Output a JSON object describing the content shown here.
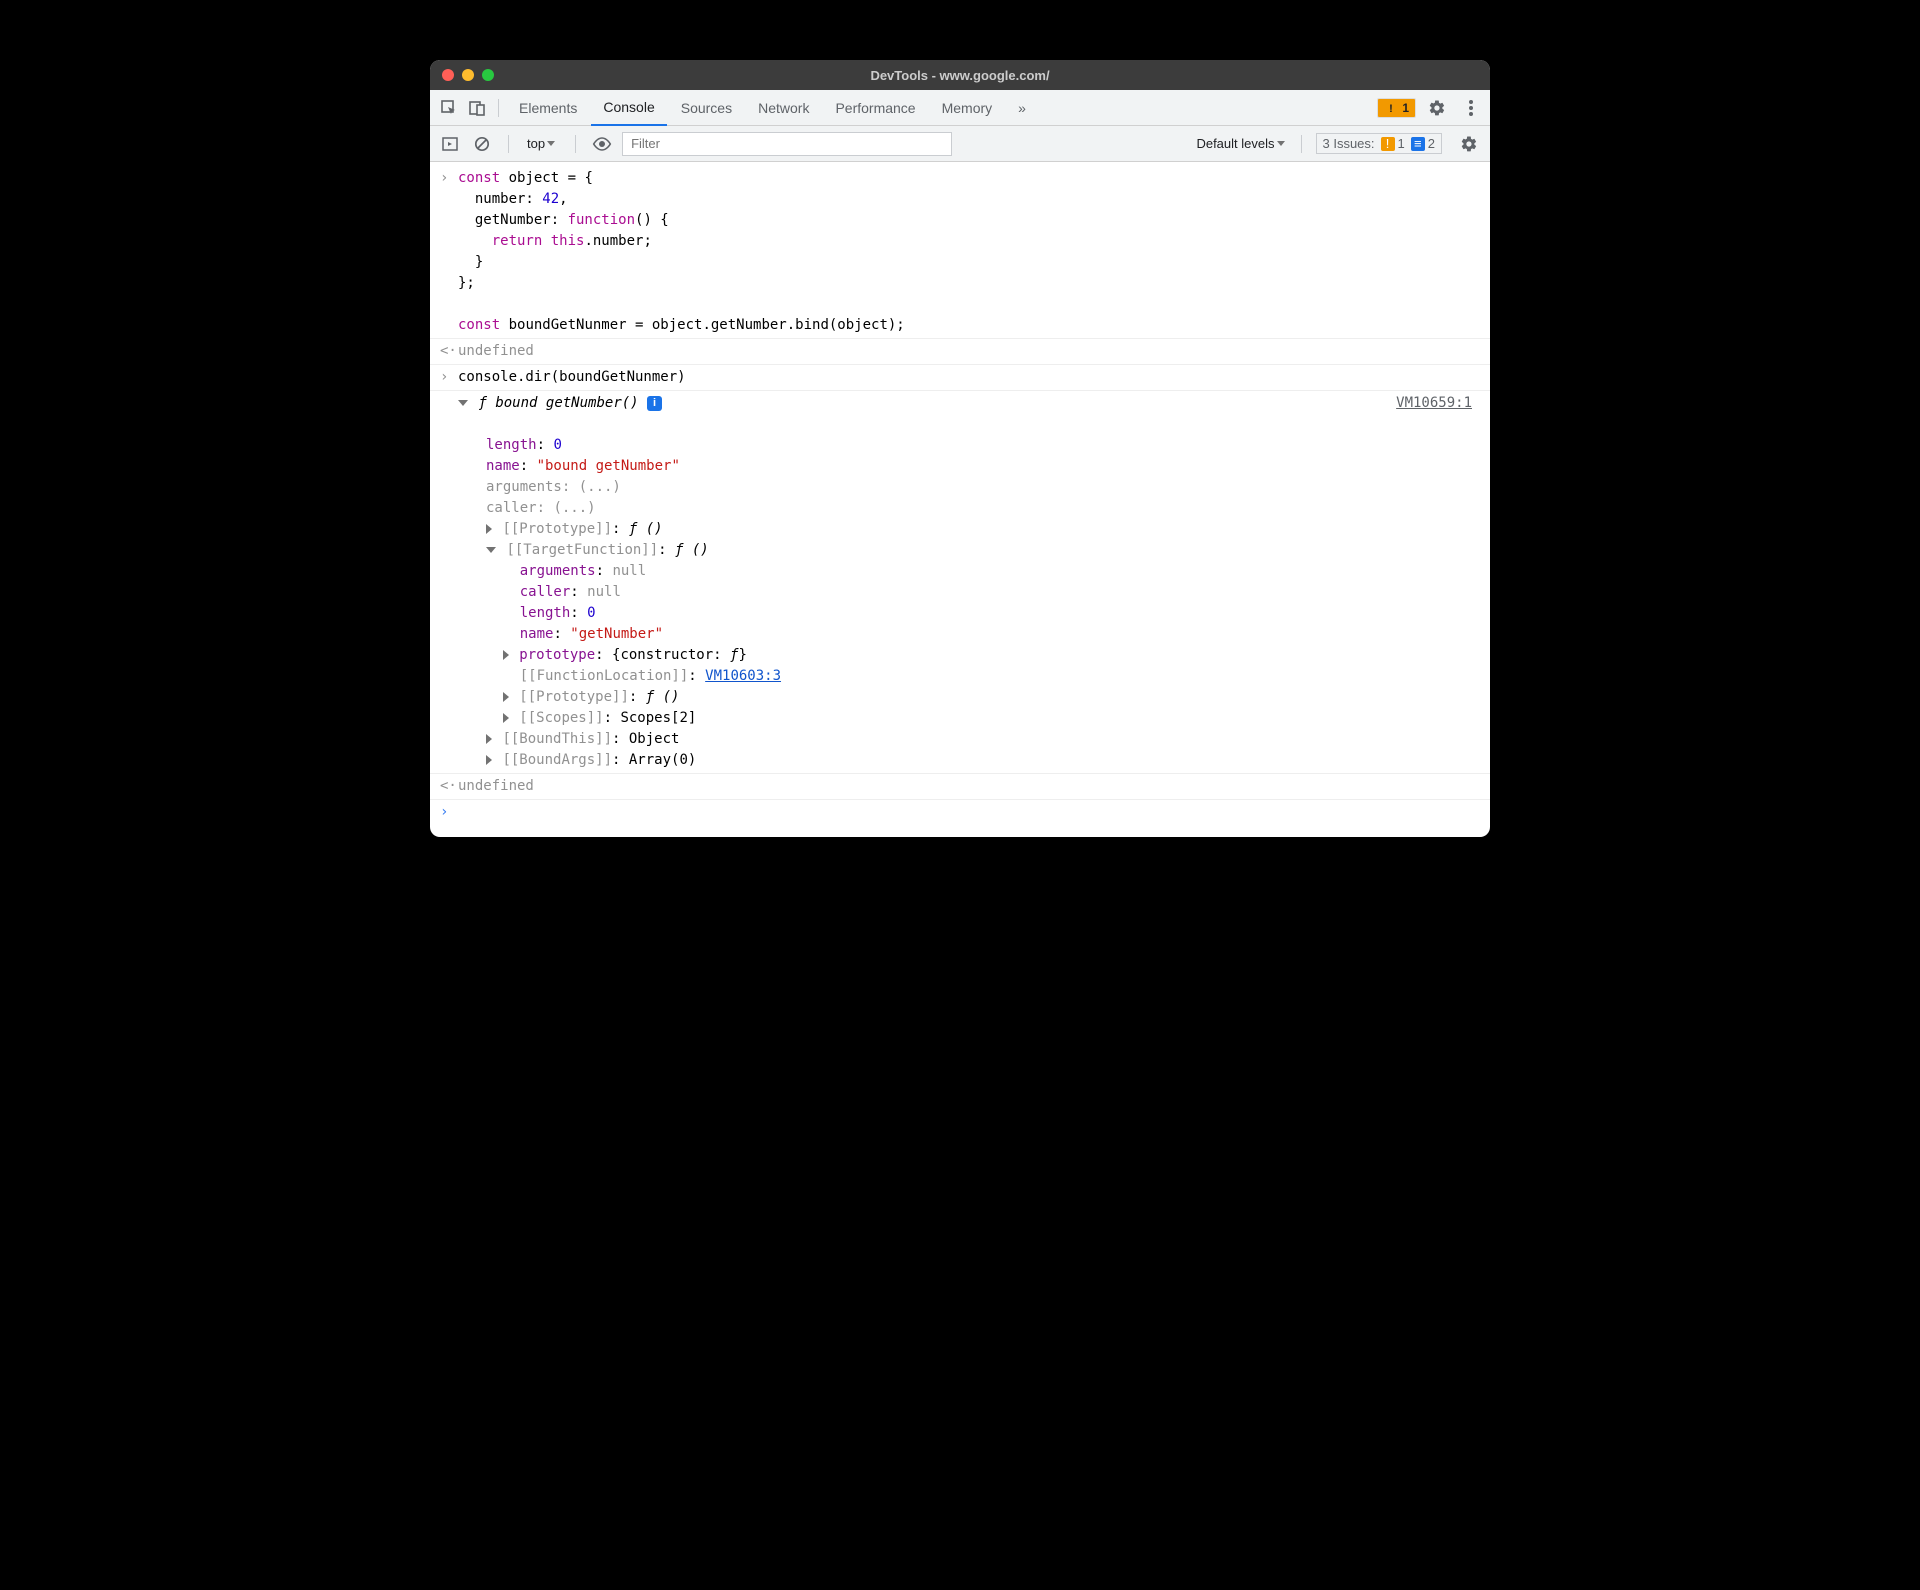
{
  "window": {
    "title": "DevTools - www.google.com/"
  },
  "tabs": {
    "items": [
      "Elements",
      "Console",
      "Sources",
      "Network",
      "Performance",
      "Memory"
    ],
    "active": "Console",
    "overflow": "»",
    "warn_count": "1"
  },
  "toolbar": {
    "context": "top",
    "filter_placeholder": "Filter",
    "levels": "Default levels",
    "issues_label": "3 Issues:",
    "issues_warn": "1",
    "issues_info": "2"
  },
  "code": {
    "l1": "const object = {",
    "l1_kw": "const",
    "l1_rest": " object = {",
    "l2_a": "  number: ",
    "l2_num": "42",
    "l2_b": ",",
    "l3_a": "  getNumber: ",
    "l3_fn": "function",
    "l3_b": "() {",
    "l4_a": "    ",
    "l4_ret": "return",
    "l4_b": " ",
    "l4_this": "this",
    "l4_c": ".number;",
    "l5": "  }",
    "l6": "};",
    "blank": "",
    "l8_kw": "const",
    "l8_rest": " boundGetNunmer = object.getNumber.bind(object);"
  },
  "result1": "undefined",
  "input2": "console.dir(boundGetNunmer)",
  "dir": {
    "header_f": "ƒ",
    "header_label": "bound getNumber()",
    "source": "VM10659:1",
    "length_k": "length",
    "length_v": "0",
    "name_k": "name",
    "name_v": "\"bound getNumber\"",
    "args_k": "arguments",
    "args_v": "(...)",
    "caller_k": "caller",
    "caller_v": "(...)",
    "proto_k": "[[Prototype]]",
    "proto_v": "ƒ ()",
    "target_k": "[[TargetFunction]]",
    "target_v": "ƒ ()",
    "t_args_k": "arguments",
    "t_args_v": "null",
    "t_caller_k": "caller",
    "t_caller_v": "null",
    "t_length_k": "length",
    "t_length_v": "0",
    "t_name_k": "name",
    "t_name_v": "\"getNumber\"",
    "t_proto_k": "prototype",
    "t_proto_v_a": "{constructor: ",
    "t_proto_v_f": "ƒ",
    "t_proto_v_b": "}",
    "t_funcloc_k": "[[FunctionLocation]]",
    "t_funcloc_v": "VM10603:3",
    "t_iproto_k": "[[Prototype]]",
    "t_iproto_v": "ƒ ()",
    "t_scopes_k": "[[Scopes]]",
    "t_scopes_v": "Scopes[2]",
    "bthis_k": "[[BoundThis]]",
    "bthis_v": "Object",
    "bargs_k": "[[BoundArgs]]",
    "bargs_v": "Array(0)"
  },
  "result2": "undefined"
}
